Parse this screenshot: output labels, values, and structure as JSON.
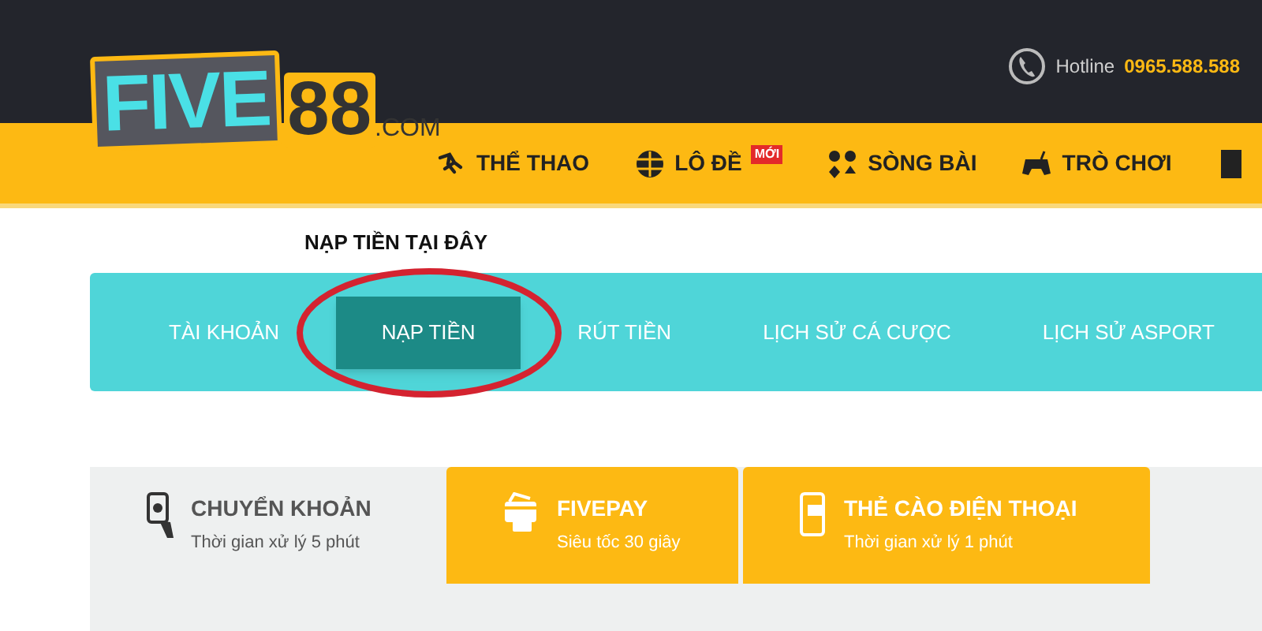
{
  "logo": {
    "brand": "FIVE",
    "number": "88",
    "domain": ".COM"
  },
  "hotline": {
    "label": "Hotline",
    "number": "0965.588.588"
  },
  "nav": [
    {
      "label": "THỂ THAO",
      "kind": "sport"
    },
    {
      "label": "LÔ ĐỀ",
      "kind": "lottery",
      "badge": "MỚI"
    },
    {
      "label": "SÒNG BÀI",
      "kind": "casino"
    },
    {
      "label": "TRÒ CHƠI",
      "kind": "game"
    }
  ],
  "caption": "NẠP TIỀN TẠI ĐÂY",
  "account_tabs": [
    {
      "label": "TÀI KHOẢN",
      "selected": false
    },
    {
      "label": "NẠP TIỀN",
      "selected": true
    },
    {
      "label": "RÚT TIỀN",
      "selected": false
    },
    {
      "label": "LỊCH SỬ CÁ CƯỢC",
      "selected": false
    },
    {
      "label": "LỊCH SỬ ASPORT",
      "selected": false
    }
  ],
  "payment_tabs": [
    {
      "title": "CHUYỂN KHOẢN",
      "subtitle": "Thời gian xử lý 5 phút",
      "kind": "transfer",
      "selected": true
    },
    {
      "title": "FIVEPAY",
      "subtitle": "Siêu tốc 30 giây",
      "kind": "card",
      "selected": false
    },
    {
      "title": "THẺ CÀO ĐIỆN THOẠI",
      "subtitle": "Thời gian xử lý 1 phút",
      "kind": "phone",
      "selected": false
    }
  ]
}
